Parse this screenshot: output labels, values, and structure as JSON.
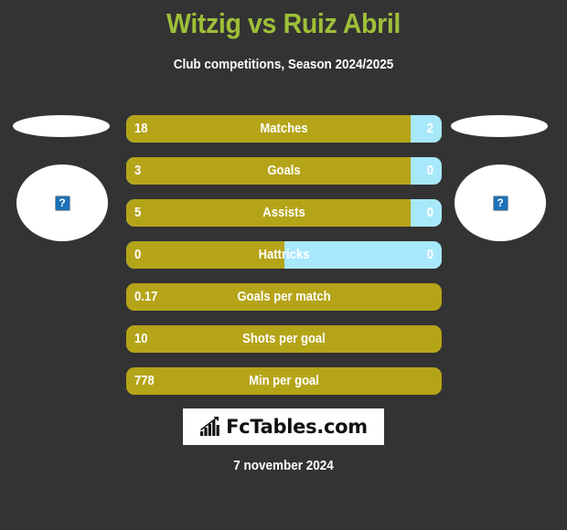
{
  "header": {
    "title": "Witzig vs Ruiz Abril",
    "subtitle": "Club competitions, Season 2024/2025",
    "title_color": "#9ec038"
  },
  "players": {
    "left": {
      "photo_icon": "broken-image-icon",
      "photo_alt": "?"
    },
    "right": {
      "photo_icon": "broken-image-icon",
      "photo_alt": "?"
    }
  },
  "colors": {
    "background": "#333333",
    "home_bar": "#b5a418",
    "away_bar": "#a8e8fb",
    "accent_green": "#9ec038"
  },
  "chart_data": {
    "type": "bar",
    "title": "Witzig vs Ruiz Abril",
    "subtitle": "Club competitions, Season 2024/2025",
    "orientation": "horizontal",
    "stacked": true,
    "legend": [
      "Witzig",
      "Ruiz Abril"
    ],
    "categories": [
      "Matches",
      "Goals",
      "Assists",
      "Hattricks",
      "Goals per match",
      "Shots per goal",
      "Min per goal"
    ],
    "series": [
      {
        "name": "Witzig",
        "color": "#b5a418",
        "values": [
          18,
          3,
          5,
          0,
          0.17,
          10,
          778
        ]
      },
      {
        "name": "Ruiz Abril",
        "color": "#a8e8fb",
        "values": [
          2,
          0,
          0,
          0,
          null,
          null,
          null
        ]
      }
    ],
    "rows": [
      {
        "label": "Matches",
        "left_value": "18",
        "right_value": "2",
        "left_pct": 90,
        "has_right": true
      },
      {
        "label": "Goals",
        "left_value": "3",
        "right_value": "0",
        "left_pct": 90,
        "has_right": true
      },
      {
        "label": "Assists",
        "left_value": "5",
        "right_value": "0",
        "left_pct": 90,
        "has_right": true
      },
      {
        "label": "Hattricks",
        "left_value": "0",
        "right_value": "0",
        "left_pct": 50,
        "has_right": true
      },
      {
        "label": "Goals per match",
        "left_value": "0.17",
        "right_value": "",
        "left_pct": 100,
        "has_right": false
      },
      {
        "label": "Shots per goal",
        "left_value": "10",
        "right_value": "",
        "left_pct": 100,
        "has_right": false
      },
      {
        "label": "Min per goal",
        "left_value": "778",
        "right_value": "",
        "left_pct": 100,
        "has_right": false
      }
    ]
  },
  "logo": {
    "text": "FcTables.com",
    "icon": "bar-chart-growth-icon"
  },
  "footer": {
    "date": "7 november 2024"
  }
}
